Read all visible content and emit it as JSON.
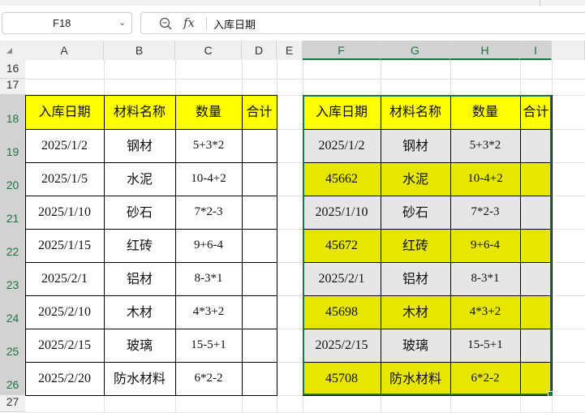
{
  "namebox": {
    "value": "F18"
  },
  "formula_bar": {
    "fx_label": "fx",
    "content": "入库日期"
  },
  "columns": [
    "A",
    "B",
    "C",
    "D",
    "E",
    "F",
    "G",
    "H",
    "I"
  ],
  "rows": [
    "16",
    "17",
    "18",
    "19",
    "20",
    "21",
    "22",
    "23",
    "24",
    "25",
    "26",
    "27"
  ],
  "selection": {
    "columns": [
      "F",
      "G",
      "H",
      "I"
    ],
    "rows": [
      "18",
      "19",
      "20",
      "21",
      "22",
      "23",
      "24",
      "25",
      "26"
    ]
  },
  "left_table": {
    "headers": [
      "入库日期",
      "材料名称",
      "数量",
      "合计"
    ],
    "rows": [
      [
        "2025/1/2",
        "钢材",
        "5+3*2",
        ""
      ],
      [
        "2025/1/5",
        "水泥",
        "10-4+2",
        ""
      ],
      [
        "2025/1/10",
        "砂石",
        "7*2-3",
        ""
      ],
      [
        "2025/1/15",
        "红砖",
        "9+6-4",
        ""
      ],
      [
        "2025/2/1",
        "铝材",
        "8-3*1",
        ""
      ],
      [
        "2025/2/10",
        "木材",
        "4*3+2",
        ""
      ],
      [
        "2025/2/15",
        "玻璃",
        "15-5+1",
        ""
      ],
      [
        "2025/2/20",
        "防水材料",
        "6*2-2",
        ""
      ]
    ]
  },
  "right_table": {
    "headers": [
      "入库日期",
      "材料名称",
      "数量",
      "合计"
    ],
    "rows": [
      [
        "2025/1/2",
        "钢材",
        "5+3*2",
        ""
      ],
      [
        "45662",
        "水泥",
        "10-4+2",
        ""
      ],
      [
        "2025/1/10",
        "砂石",
        "7*2-3",
        ""
      ],
      [
        "45672",
        "红砖",
        "9+6-4",
        ""
      ],
      [
        "2025/2/1",
        "铝材",
        "8-3*1",
        ""
      ],
      [
        "45698",
        "木材",
        "4*3+2",
        ""
      ],
      [
        "2025/2/15",
        "玻璃",
        "15-5+1",
        ""
      ],
      [
        "45708",
        "防水材料",
        "6*2-2",
        ""
      ]
    ],
    "row_fills": [
      "gray",
      "yellow",
      "gray",
      "yellow",
      "gray",
      "yellow",
      "gray",
      "yellow"
    ]
  },
  "colors": {
    "header_yellow": "#ffff00",
    "row_yellow": "#e6e600",
    "row_gray": "#e6e6e6",
    "selection_green": "#217346"
  }
}
